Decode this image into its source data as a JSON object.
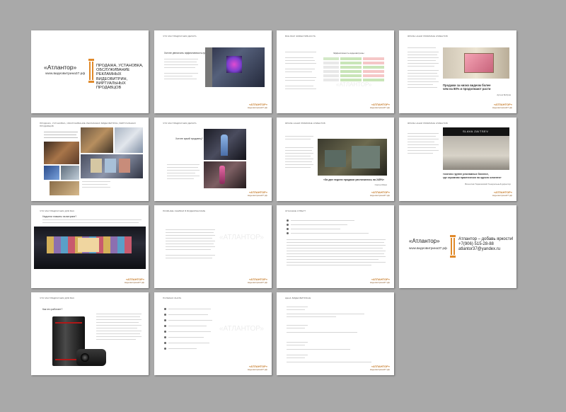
{
  "colors": {
    "accent": "#e08a2b",
    "background": "#a9a9a9",
    "page": "#ffffff"
  },
  "cover": {
    "brand": "«Атлантор»",
    "site": "www.видеовитрина37.рф",
    "subtitle_lines": [
      "ПРОДАЖА, УСТАНОВКА, ОБСЛУЖИВАНИЕ",
      "РЕКЛАМНЫХ ВИДЕОВИТРИН,",
      "ВИРТУАЛЬНЫХ ПРОДАВЦОВ"
    ]
  },
  "p2": {
    "header": "ЧТО МЫ ПРЕДЛАГАЕМ ДЕЛАТЬ",
    "question": "Хотите увеличить эффективность продаж?"
  },
  "p3": {
    "header": "ВСЕ БЫЛ ЭФФЕКТИВНОСТЬ",
    "table_title": "Эффективность видеовитрины"
  },
  "p4": {
    "header": "ЯРКИЕ НАШИ ЛЮБИМЫЕ КЛИЕНТОВ",
    "quote_lines": [
      "Продажи за низко видеом более",
      "чем на 80% и продолжают расти"
    ],
    "author": "Артем Бобров"
  },
  "p5": {
    "header": "ПРОДАЖА, УСТАНОВКА, ОБСЛУЖИВАНИЕ РЕКЛАМНЫХ ВИДЕОВИТРИН, ВИРТУАЛЬНЫХ ПРОДАВЦОВ"
  },
  "p6": {
    "header": "ЧТО МЫ ПРЕДЛАГАЕМ ДЕЛАТЬ",
    "question": "Хотите яркий продавец?"
  },
  "p7": {
    "header": "ЯРКИЕ НАШИ ЛЮБИМЫЕ КЛИЕНТОВ",
    "quote": "«За две недели продажи увеличились на 245%»",
    "author": "Салон Мини"
  },
  "p8": {
    "header": "ЯРКИЕ НАШИ ЛЮБИМЫЕ КЛИЕНТОВ",
    "sign": "SLAVA ZAITSEV",
    "quote_lines": [
      "точечно группе рекламных бизнесе,",
      "где огромная практически на одного клиента»"
    ],
    "author": "Вячеслав Тарасевский Генеральный директор"
  },
  "p9": {
    "header": "ЧТО МЫ ПРЕДЛАГАЕМ ДЛЯ ВАС",
    "question": "Надоели плакаты на витрине?"
  },
  "p10": {
    "header": "ПЛАВНЫЕ ОШИБКИ В ВИДЕОРЕКЛАМЕ"
  },
  "p11": {
    "header": "ОПАСНЫЕ ОТВЕТ?"
  },
  "contacts": {
    "brand": "«Атлантор»",
    "site": "www.видеовитрина37.рф",
    "slogan": "Атлантор – добавь яркости!",
    "phone": "+7(906) 515-28-88",
    "email": "atlantor37@yandex.ru"
  },
  "p13": {
    "header": "ЧТО МЫ ПРЕДЛАГАЕМ ДЛЯ ВАС",
    "question": "Как это работает?"
  },
  "p14": {
    "header": "ПОЛЕЗНО ЗНАТЬ"
  },
  "p15": {
    "header": "ЦЕНА ВИДЕОВИТРИНЫ"
  },
  "footer_logo": {
    "brand": "«АТЛАНТОР»",
    "site": "видеовитрина37.рф"
  }
}
